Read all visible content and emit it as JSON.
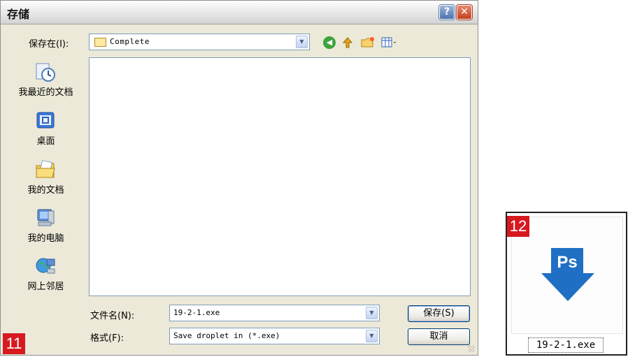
{
  "dialog": {
    "title": "存储",
    "help_symbol": "?",
    "close_symbol": "✕",
    "look_in_label": "保存在(I):",
    "look_in_value": "Complete",
    "places": [
      {
        "label": "我最近的文档",
        "icon": "recent-documents-icon"
      },
      {
        "label": "桌面",
        "icon": "desktop-icon"
      },
      {
        "label": "我的文档",
        "icon": "my-documents-icon"
      },
      {
        "label": "我的电脑",
        "icon": "my-computer-icon"
      },
      {
        "label": "网上邻居",
        "icon": "network-places-icon"
      }
    ],
    "filename_label": "文件名(N):",
    "filename_value": "19-2-1.exe",
    "format_label": "格式(F):",
    "format_value": "Save droplet in (*.exe)",
    "save_button": "保存(S)",
    "cancel_button": "取消",
    "step_badge": "11"
  },
  "droplet": {
    "step_badge": "12",
    "icon_text": "Ps",
    "file_name": "19-2-1.exe"
  },
  "colors": {
    "badge": "#d71920",
    "ps_arrow": "#1f6fc4"
  }
}
